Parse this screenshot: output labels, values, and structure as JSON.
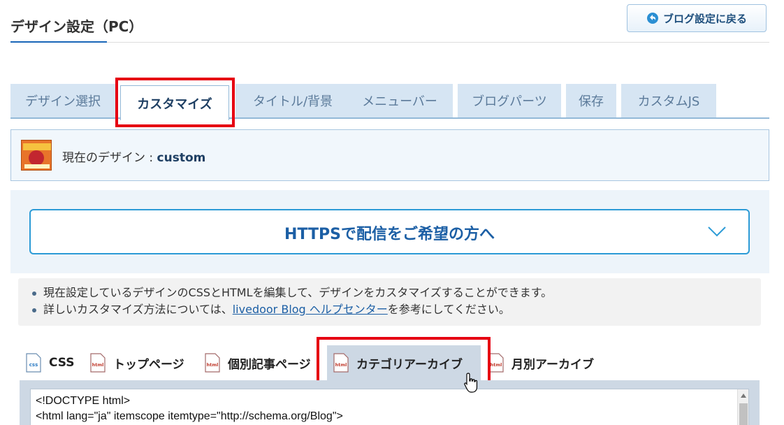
{
  "header": {
    "title": "デザイン設定（PC）",
    "back_button_label": "ブログ設定に戻る"
  },
  "tabs": [
    {
      "label": "デザイン選択",
      "active": false
    },
    {
      "label": "カスタマイズ",
      "active": true
    },
    {
      "label": "タイトル/背景",
      "active": false
    },
    {
      "label": "メニューバー",
      "active": false
    },
    {
      "label": "ブログパーツ",
      "active": false
    },
    {
      "label": "保存",
      "active": false
    },
    {
      "label": "カスタムJS",
      "active": false
    }
  ],
  "current_design": {
    "prefix": "現在のデザイン : ",
    "name": "custom"
  },
  "https_panel": {
    "label": "HTTPSで配信をご希望の方へ",
    "icon": "chevron-down-icon"
  },
  "info": {
    "line1": "現在設定しているデザインのCSSとHTMLを編集して、デザインをカスタマイズすることができます。",
    "line2_before": "詳しいカスタマイズ方法については、",
    "line2_link": "livedoor Blog ヘルプセンター",
    "line2_after": "を参考にしてください。"
  },
  "file_tabs": [
    {
      "label": "CSS",
      "icon": "css-file-icon",
      "active": false
    },
    {
      "label": "トップページ",
      "icon": "html-file-icon",
      "active": false
    },
    {
      "label": "個別記事ページ",
      "icon": "html-file-icon",
      "active": false
    },
    {
      "label": "カテゴリアーカイブ",
      "icon": "html-file-icon",
      "active": true
    },
    {
      "label": "月別アーカイブ",
      "icon": "html-file-icon",
      "active": false
    }
  ],
  "editor": {
    "lines": [
      "<!DOCTYPE html>",
      "<html lang=\"ja\" itemscope itemtype=\"http://schema.org/Blog\">"
    ]
  },
  "colors": {
    "accent": "#1c5fa5",
    "highlight": "#e60012",
    "tab_bg": "#d6e5f3",
    "https_border": "#2c9bd6"
  }
}
